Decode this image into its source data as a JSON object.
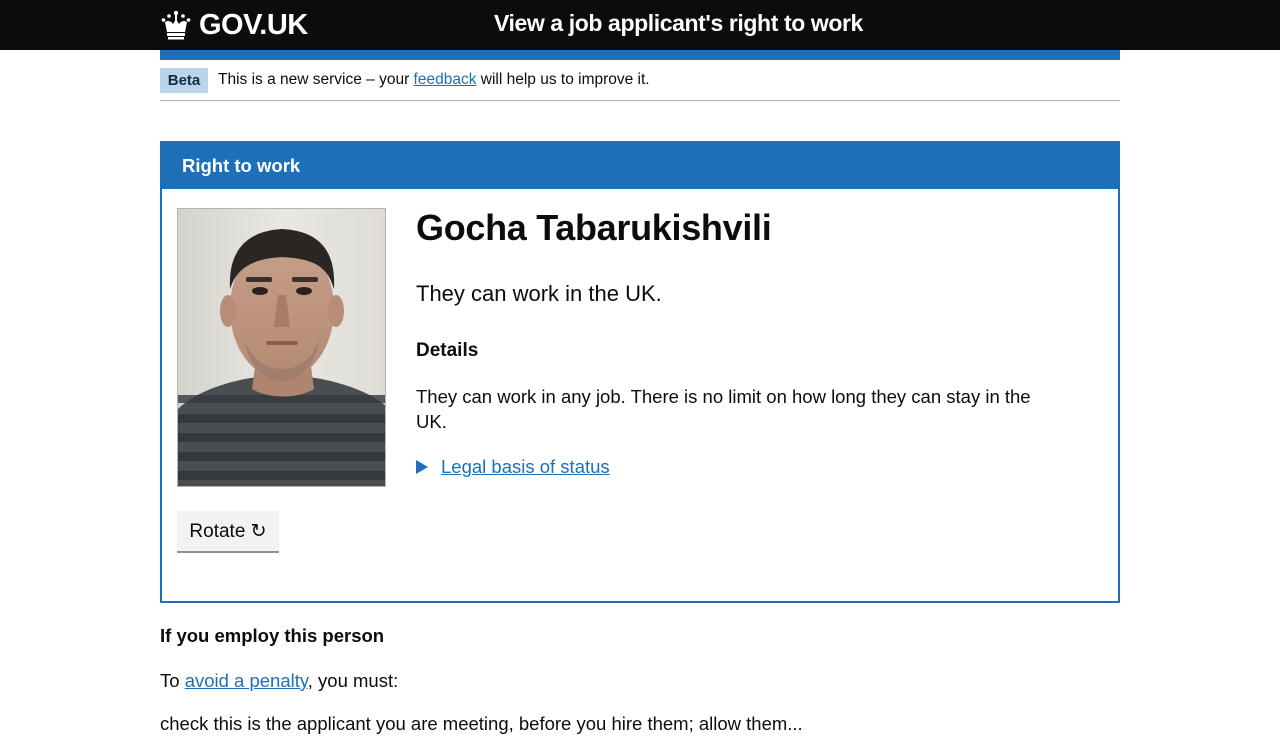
{
  "header": {
    "logo_text": "GOV.UK",
    "service_name": "View a job applicant's right to work"
  },
  "phase_banner": {
    "tag": "Beta",
    "text_before": "This is a new service – your ",
    "link_text": "feedback",
    "text_after": " will help us to improve it."
  },
  "panel": {
    "heading": "Right to work",
    "name": "Gocha Tabarukishvili",
    "status": "They can work in the UK.",
    "details_heading": "Details",
    "details_text": "They can work in any job. There is no limit on how long they can stay in the UK.",
    "legal_basis_link": "Legal basis of status",
    "rotate_label": "Rotate ↻"
  },
  "employ": {
    "heading": "If you employ this person",
    "to_text": "To ",
    "penalty_link": "avoid a penalty",
    "must_text": ", you must:",
    "first_item": "check this is the applicant you are meeting, before you hire them; allow them..."
  },
  "colors": {
    "header_bg": "#0b0c0c",
    "brand_blue": "#1d70b8",
    "tag_bg": "#bbd4ea",
    "button_bg": "#f3f2f1"
  }
}
